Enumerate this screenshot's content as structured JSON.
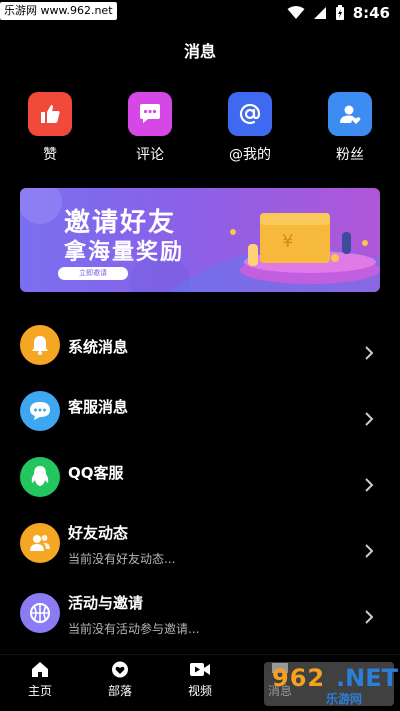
{
  "statusbar": {
    "watermark": "乐游网 www.962.net",
    "time": "8:46"
  },
  "header": {
    "title": "消息"
  },
  "quick_actions": [
    {
      "label": "赞",
      "icon": "thumbs-up-icon",
      "color": "#f24a3a"
    },
    {
      "label": "评论",
      "icon": "comment-icon",
      "color": "#d548e6"
    },
    {
      "label": "@我的",
      "icon": "at-icon",
      "color": "#3f6af0"
    },
    {
      "label": "粉丝",
      "icon": "user-heart-icon",
      "color": "#3c8cf2"
    }
  ],
  "banner": {
    "line1": "邀请好友",
    "line2": "拿海量奖励",
    "button": "立即邀请"
  },
  "messages": [
    {
      "title": "系统消息",
      "subtitle": "",
      "icon": "bell-icon",
      "color": "#f5a623"
    },
    {
      "title": "客服消息",
      "subtitle": "",
      "icon": "chat-bubble-icon",
      "color": "#3fa7f2"
    },
    {
      "title": "QQ客服",
      "subtitle": "",
      "icon": "qq-penguin-icon",
      "color": "#22c55e"
    },
    {
      "title": "好友动态",
      "subtitle": "当前没有好友动态...",
      "icon": "friends-icon",
      "color": "#f5a623"
    },
    {
      "title": "活动与邀请",
      "subtitle": "当前没有活动参与邀请...",
      "icon": "basketball-icon",
      "color": "#8b7cf6"
    }
  ],
  "tabs": [
    {
      "label": "主页",
      "icon": "home-icon"
    },
    {
      "label": "部落",
      "icon": "heart-icon"
    },
    {
      "label": "视频",
      "icon": "video-icon"
    },
    {
      "label": "消息",
      "icon": "message-icon"
    }
  ],
  "watermark_bottom": {
    "brand": "962",
    "suffix": ".NET",
    "sub": "乐游网"
  }
}
